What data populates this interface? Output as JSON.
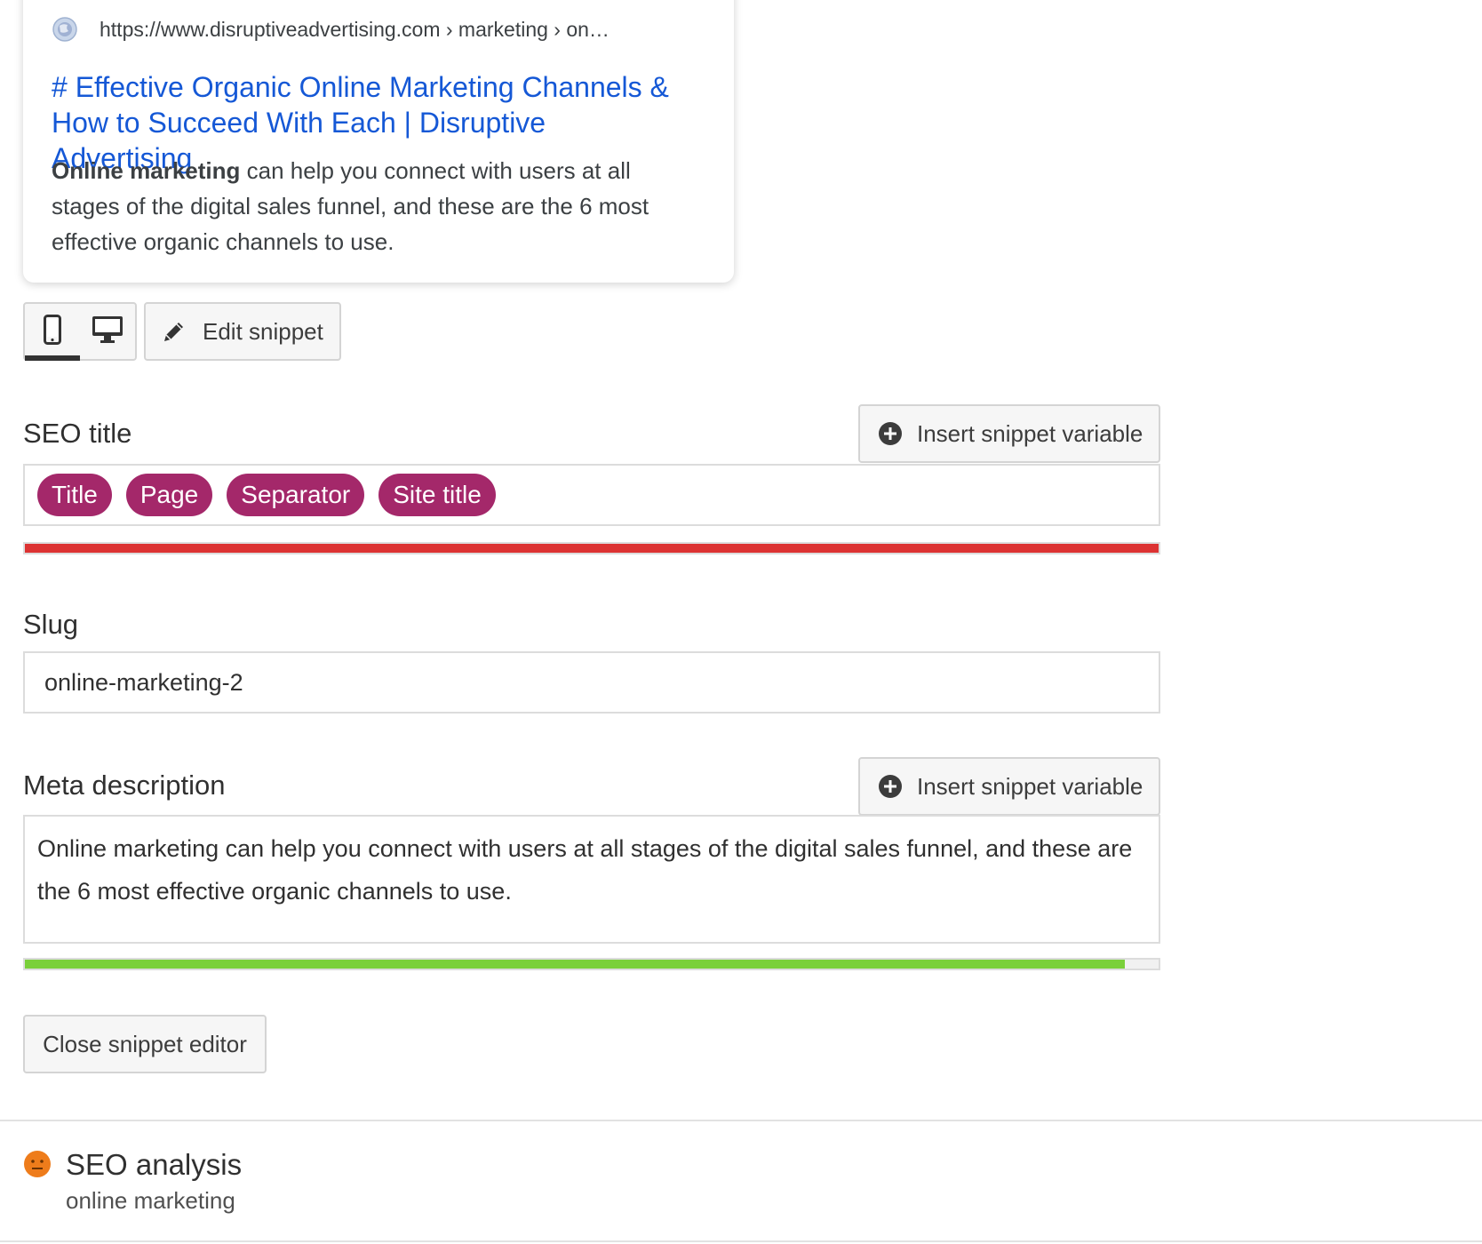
{
  "preview": {
    "url": "https://www.disruptiveadvertising.com › marketing › on…",
    "title": "# Effective Organic Online Marketing Channels & How to Succeed With Each | Disruptive Advertising",
    "desc_bold": "Online marketing",
    "desc_rest": " can help you connect with users at all stages of the digital sales funnel, and these are the 6 most effective organic channels to use."
  },
  "toolbar": {
    "mobile_icon": "mobile-phone-icon",
    "desktop_icon": "desktop-monitor-icon",
    "active_mode": "mobile",
    "edit_snippet_label": "Edit snippet"
  },
  "seo_title": {
    "label": "SEO title",
    "insert_label": "Insert snippet variable",
    "variables": [
      "Title",
      "Page",
      "Separator",
      "Site title"
    ],
    "progress": 1.0,
    "progress_color": "#dc3232"
  },
  "slug": {
    "label": "Slug",
    "value": "online-marketing-2"
  },
  "meta_description": {
    "label": "Meta description",
    "insert_label": "Insert snippet variable",
    "value": "Online marketing can help you connect with users at all stages of the digital sales funnel, and these are the 6 most effective organic channels to use.",
    "progress": 0.97,
    "progress_color": "#7ad03a"
  },
  "close_editor_label": "Close snippet editor",
  "analysis": {
    "title": "SEO analysis",
    "keyword": "online marketing",
    "status_icon": "neutral-face-icon",
    "status_color": "#ee7c1b"
  }
}
